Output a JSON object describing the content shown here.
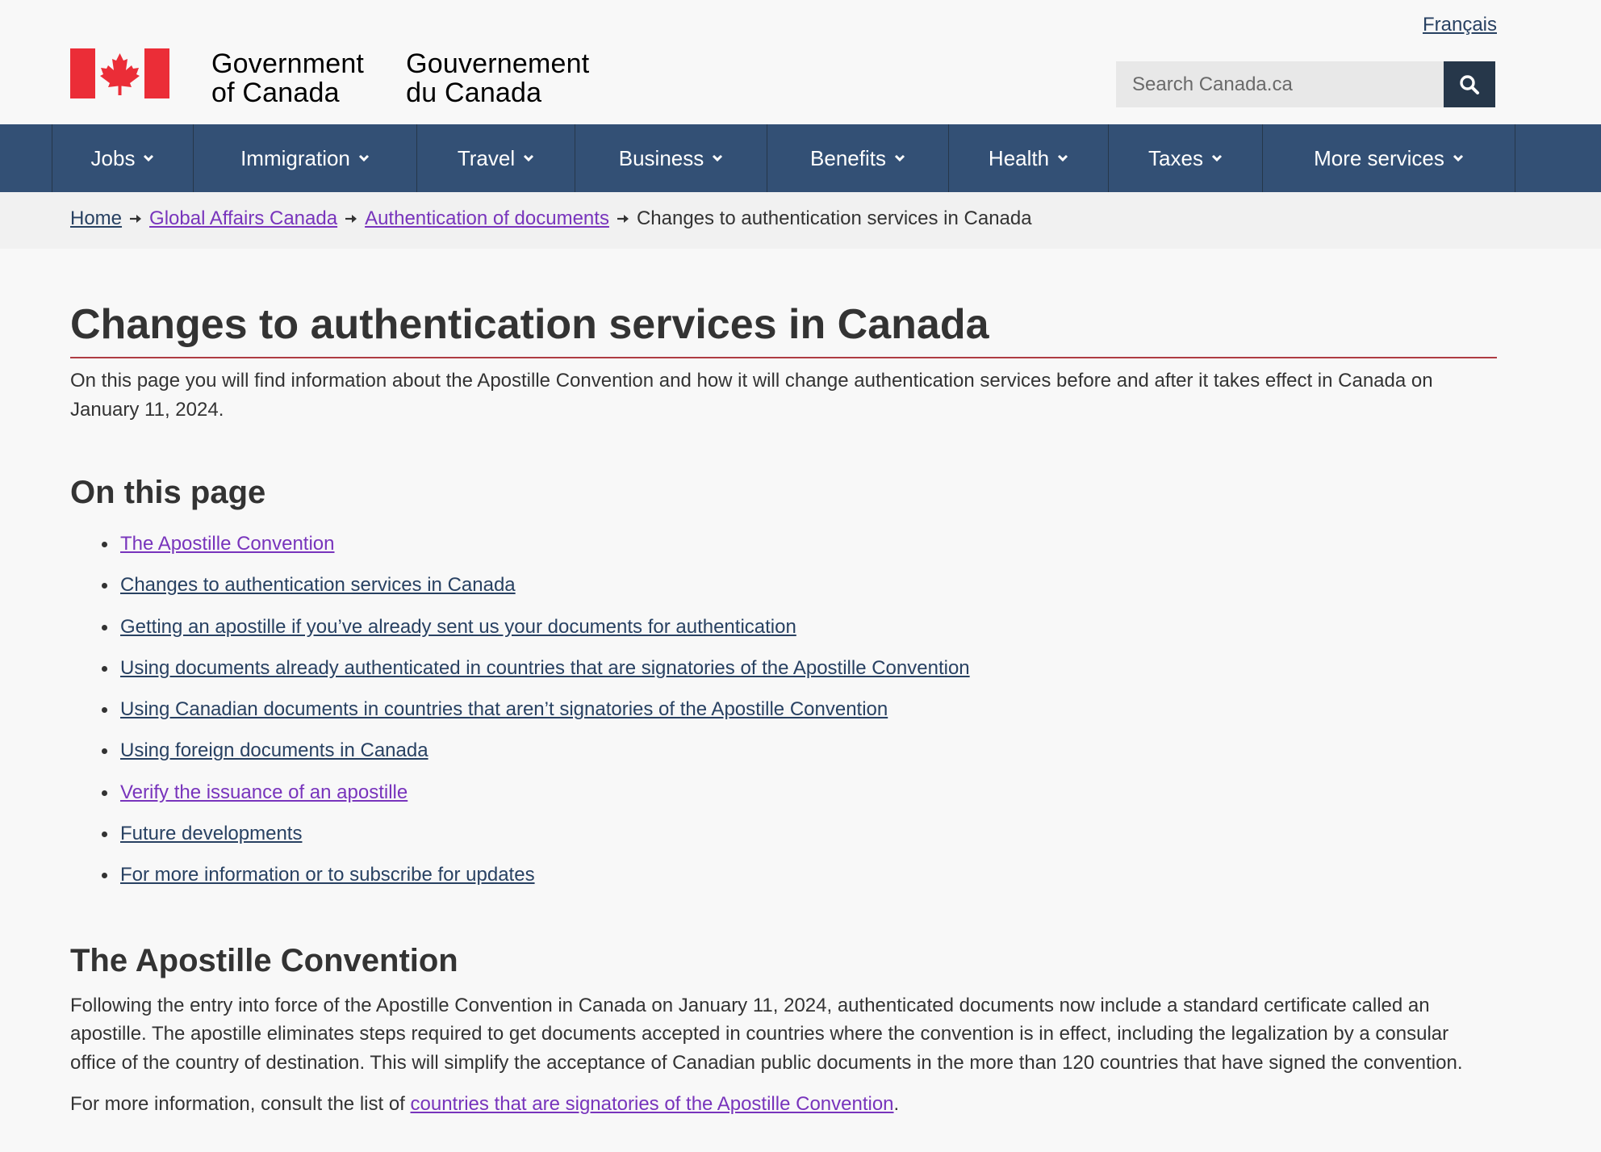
{
  "header": {
    "language_link": "Français",
    "wordmark_en": [
      "Government",
      "of Canada"
    ],
    "wordmark_fr": [
      "Gouvernement",
      "du Canada"
    ],
    "search": {
      "placeholder": "Search Canada.ca",
      "value": ""
    },
    "colors": {
      "flag_red": "#eb2d37",
      "nav_blue": "#335075",
      "search_button": "#26374a"
    }
  },
  "menu": {
    "items": [
      {
        "label": "Jobs"
      },
      {
        "label": "Immigration"
      },
      {
        "label": "Travel"
      },
      {
        "label": "Business"
      },
      {
        "label": "Benefits"
      },
      {
        "label": "Health"
      },
      {
        "label": "Taxes"
      },
      {
        "label": "More services"
      }
    ]
  },
  "breadcrumb": {
    "items": [
      {
        "label": "Home",
        "visited": false
      },
      {
        "label": "Global Affairs Canada",
        "visited": true
      },
      {
        "label": "Authentication of documents",
        "visited": true
      }
    ],
    "current": "Changes to authentication services in Canada"
  },
  "page": {
    "title": "Changes to authentication services in Canada",
    "intro": "On this page you will find information about the Apostille Convention and how it will change authentication services before and after it takes effect in Canada on January 11, 2024.",
    "toc_title": "On this page",
    "toc": [
      {
        "label": "The Apostille Convention",
        "visited": true
      },
      {
        "label": "Changes to authentication services in Canada",
        "visited": false
      },
      {
        "label": "Getting an apostille if you’ve already sent us your documents for authentication",
        "visited": false
      },
      {
        "label": "Using documents already authenticated in countries that are signatories of the Apostille Convention",
        "visited": false
      },
      {
        "label": "Using Canadian documents in countries that aren’t signatories of the Apostille Convention",
        "visited": false
      },
      {
        "label": "Using foreign documents in Canada",
        "visited": false
      },
      {
        "label": "Verify the issuance of an apostille",
        "visited": true
      },
      {
        "label": "Future developments",
        "visited": false
      },
      {
        "label": "For more information or to subscribe for updates",
        "visited": false
      }
    ],
    "section": {
      "title": "The Apostille Convention",
      "paragraph": "Following the entry into force of the Apostille Convention in Canada on January 11, 2024, authenticated documents now include a standard certificate called an apostille. The apostille eliminates steps required to get documents accepted in countries where the convention is in effect, including the legalization by a consular office of the country of destination. This will simplify the acceptance of Canadian public documents in the more than 120 countries that have signed the convention.",
      "more_prefix": "For more information, consult the list of ",
      "more_link": "countries that are signatories of the Apostille Convention",
      "more_suffix": "."
    }
  }
}
